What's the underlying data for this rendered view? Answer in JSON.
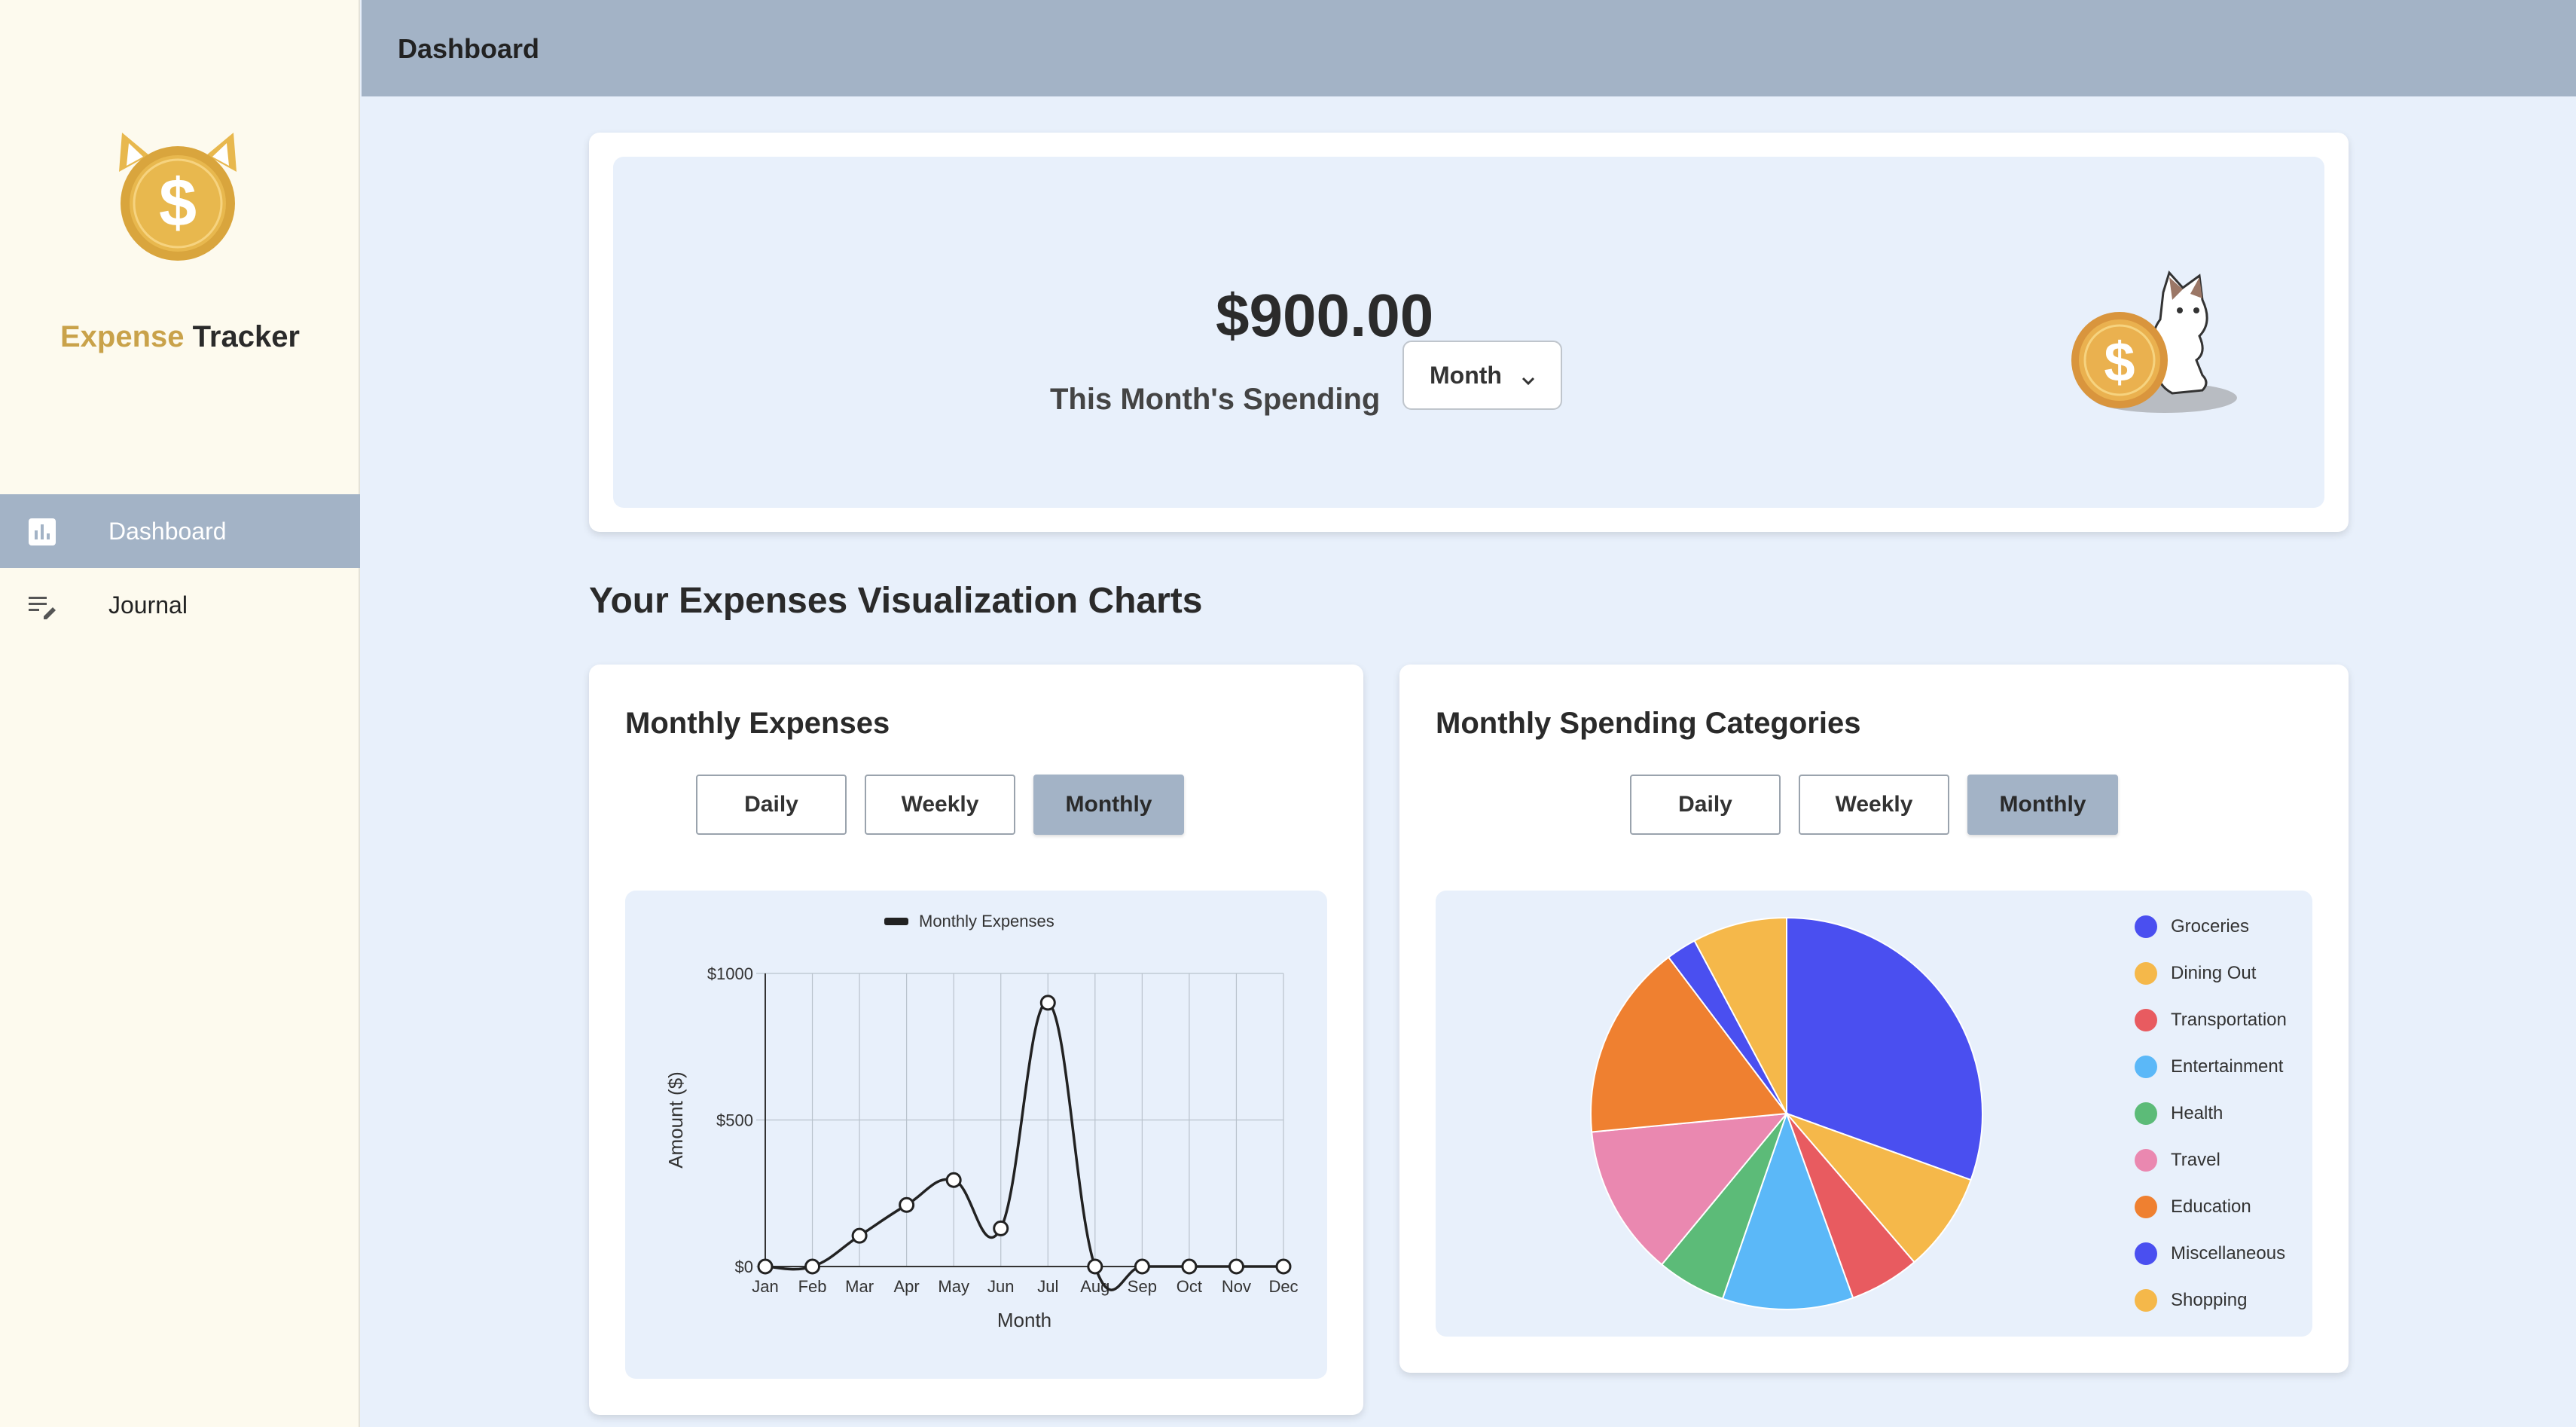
{
  "app": {
    "brand_accent": "Expense",
    "brand_rest": "Tracker"
  },
  "sidebar": {
    "items": [
      {
        "label": "Dashboard",
        "icon": "bar-chart-icon",
        "active": true
      },
      {
        "label": "Journal",
        "icon": "edit-list-icon",
        "active": false
      }
    ]
  },
  "header": {
    "title": "Dashboard"
  },
  "summary": {
    "amount": "$900.00",
    "label": "This Month's Spending",
    "period_select": "Month"
  },
  "section_title": "Your Expenses Visualization Charts",
  "line_card": {
    "title": "Monthly Expenses",
    "buttons": [
      "Daily",
      "Weekly",
      "Monthly"
    ],
    "active_button": "Monthly"
  },
  "pie_card": {
    "title": "Monthly Spending Categories",
    "buttons": [
      "Daily",
      "Weekly",
      "Monthly"
    ],
    "active_button": "Monthly"
  },
  "colors": {
    "sidebar_bg": "#fdfaee",
    "header_bg": "#a3b3c6",
    "page_bg": "#e8f0fb",
    "brand_accent": "#c9a24a"
  },
  "chart_data": [
    {
      "type": "line",
      "title": "",
      "legend": [
        "Monthly Expenses"
      ],
      "xlabel": "Month",
      "ylabel": "Amount ($)",
      "categories": [
        "Jan",
        "Feb",
        "Mar",
        "Apr",
        "May",
        "Jun",
        "Jul",
        "Aug",
        "Sep",
        "Oct",
        "Nov",
        "Dec"
      ],
      "series": [
        {
          "name": "Monthly Expenses",
          "values": [
            0,
            0,
            105,
            210,
            295,
            130,
            900,
            0,
            0,
            0,
            0,
            0
          ]
        }
      ],
      "ylim": [
        0,
        1000
      ],
      "yticks": [
        "$0",
        "$500",
        "$1000"
      ],
      "grid": true,
      "legend_position": "top"
    },
    {
      "type": "pie",
      "title": "",
      "legend_position": "right",
      "slices": [
        {
          "label": "Groceries",
          "value": 30.5,
          "color": "#4a4ff0"
        },
        {
          "label": "Dining Out",
          "value": 8.2,
          "color": "#f5b84a"
        },
        {
          "label": "Transportation",
          "value": 5.8,
          "color": "#e85b60"
        },
        {
          "label": "Entertainment",
          "value": 10.8,
          "color": "#5bb8f8"
        },
        {
          "label": "Health",
          "value": 5.7,
          "color": "#5cbb78"
        },
        {
          "label": "Travel",
          "value": 12.5,
          "color": "#ea88b0"
        },
        {
          "label": "Education",
          "value": 16.2,
          "color": "#ef8030"
        },
        {
          "label": "Miscellaneous",
          "value": 2.5,
          "color": "#4a4ff0"
        },
        {
          "label": "Shopping",
          "value": 7.8,
          "color": "#f5b84a"
        }
      ]
    }
  ]
}
